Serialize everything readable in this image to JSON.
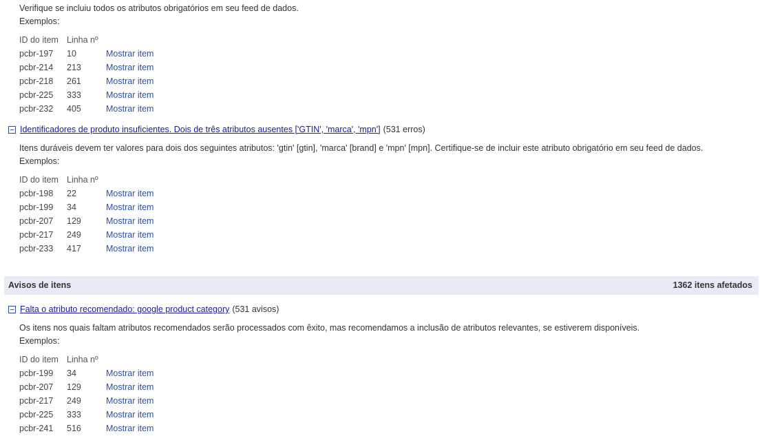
{
  "block1": {
    "description": "Verifique se incluiu todos os atributos obrigatórios em seu feed de dados.",
    "examples_label": "Exemplos:",
    "col_id": "ID do item",
    "col_line": "Linha nº",
    "rows": [
      {
        "id": "pcbr-197",
        "line": "10",
        "link": "Mostrar item"
      },
      {
        "id": "pcbr-214",
        "line": "213",
        "link": "Mostrar item"
      },
      {
        "id": "pcbr-218",
        "line": "261",
        "link": "Mostrar item"
      },
      {
        "id": "pcbr-225",
        "line": "333",
        "link": "Mostrar item"
      },
      {
        "id": "pcbr-232",
        "line": "405",
        "link": "Mostrar item"
      }
    ]
  },
  "block2": {
    "title": "Identificadores de produto insuficientes. Dois de três atributos ausentes ['GTIN', 'marca', 'mpn']",
    "count": "(531 erros)",
    "description": "Itens duráveis devem ter valores para dois dos seguintes atributos: 'gtin' [gtin], 'marca' [brand] e 'mpn' [mpn]. Certifique-se de incluir este atributo obrigatório em seu feed de dados.",
    "examples_label": "Exemplos:",
    "col_id": "ID do item",
    "col_line": "Linha nº",
    "rows": [
      {
        "id": "pcbr-198",
        "line": "22",
        "link": "Mostrar item"
      },
      {
        "id": "pcbr-199",
        "line": "34",
        "link": "Mostrar item"
      },
      {
        "id": "pcbr-207",
        "line": "129",
        "link": "Mostrar item"
      },
      {
        "id": "pcbr-217",
        "line": "249",
        "link": "Mostrar item"
      },
      {
        "id": "pcbr-233",
        "line": "417",
        "link": "Mostrar item"
      }
    ]
  },
  "warnings_bar": {
    "title": "Avisos de itens",
    "affected": "1362 itens afetados"
  },
  "block3": {
    "title": "Falta o atributo recomendado: google product category",
    "count": "(531 avisos)",
    "description": "Os itens nos quais faltam atributos recomendados serão processados com êxito, mas recomendamos a inclusão de atributos relevantes, se estiverem disponíveis.",
    "examples_label": "Exemplos:",
    "col_id": "ID do item",
    "col_line": "Linha nº",
    "rows": [
      {
        "id": "pcbr-199",
        "line": "34",
        "link": "Mostrar item"
      },
      {
        "id": "pcbr-207",
        "line": "129",
        "link": "Mostrar item"
      },
      {
        "id": "pcbr-217",
        "line": "249",
        "link": "Mostrar item"
      },
      {
        "id": "pcbr-225",
        "line": "333",
        "link": "Mostrar item"
      },
      {
        "id": "pcbr-241",
        "line": "516",
        "link": "Mostrar item"
      }
    ]
  },
  "colors": {
    "link": "#2a4fa8",
    "issue_link": "#1a1a99",
    "bar_background": "#e6ebf5",
    "text": "#333333"
  },
  "icons": {
    "toggle": "collapse-minus-icon"
  }
}
